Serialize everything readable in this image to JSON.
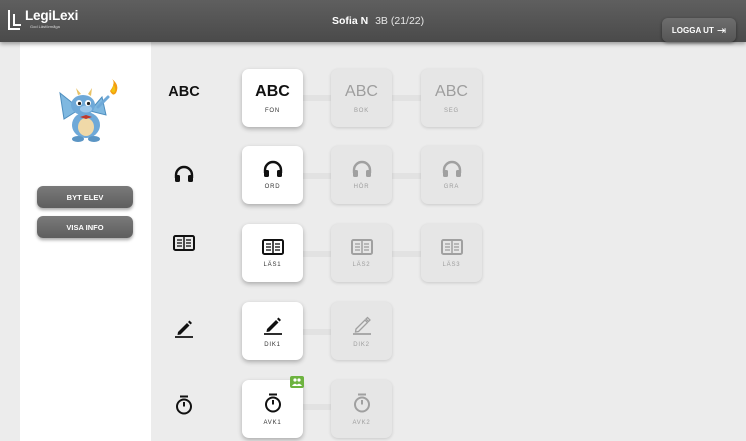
{
  "header": {
    "logo_name": "LegiLexi",
    "logo_tagline": "God Läsförmåga",
    "user_name": "Sofia N",
    "user_class": "3B (21/22)",
    "logout_label": "LOGGA UT"
  },
  "sidebar": {
    "avatar_icon": "dragon-mascot",
    "buttons": [
      "BYT ELEV",
      "VISA INFO"
    ]
  },
  "rows": [
    {
      "name": "abc",
      "row_label": "ABC",
      "icon": "abc-text",
      "cards": [
        {
          "text": "ABC",
          "label": "FON",
          "active": true
        },
        {
          "text": "ABC",
          "label": "BOK",
          "active": false
        },
        {
          "text": "ABC",
          "label": "SEG",
          "active": false
        }
      ]
    },
    {
      "name": "listen",
      "icon": "headphones-icon",
      "cards": [
        {
          "label": "ORD",
          "active": true
        },
        {
          "label": "HÖR",
          "active": false
        },
        {
          "label": "GRA",
          "active": false
        }
      ]
    },
    {
      "name": "read",
      "icon": "book-icon",
      "cards": [
        {
          "label": "LÄS1",
          "active": true
        },
        {
          "label": "LÄS2",
          "active": false
        },
        {
          "label": "LÄS3",
          "active": false
        }
      ]
    },
    {
      "name": "write",
      "icon": "pencil-icon",
      "cards": [
        {
          "label": "DIK1",
          "active": true
        },
        {
          "label": "DIK2",
          "active": false
        }
      ]
    },
    {
      "name": "timer",
      "icon": "stopwatch-icon",
      "cards": [
        {
          "label": "AVK1",
          "active": true,
          "badge": "group-icon"
        },
        {
          "label": "AVK2",
          "active": false
        }
      ]
    }
  ],
  "colors": {
    "badge": "#6db33f",
    "header": "#555555",
    "button": "#6a6a6a"
  }
}
